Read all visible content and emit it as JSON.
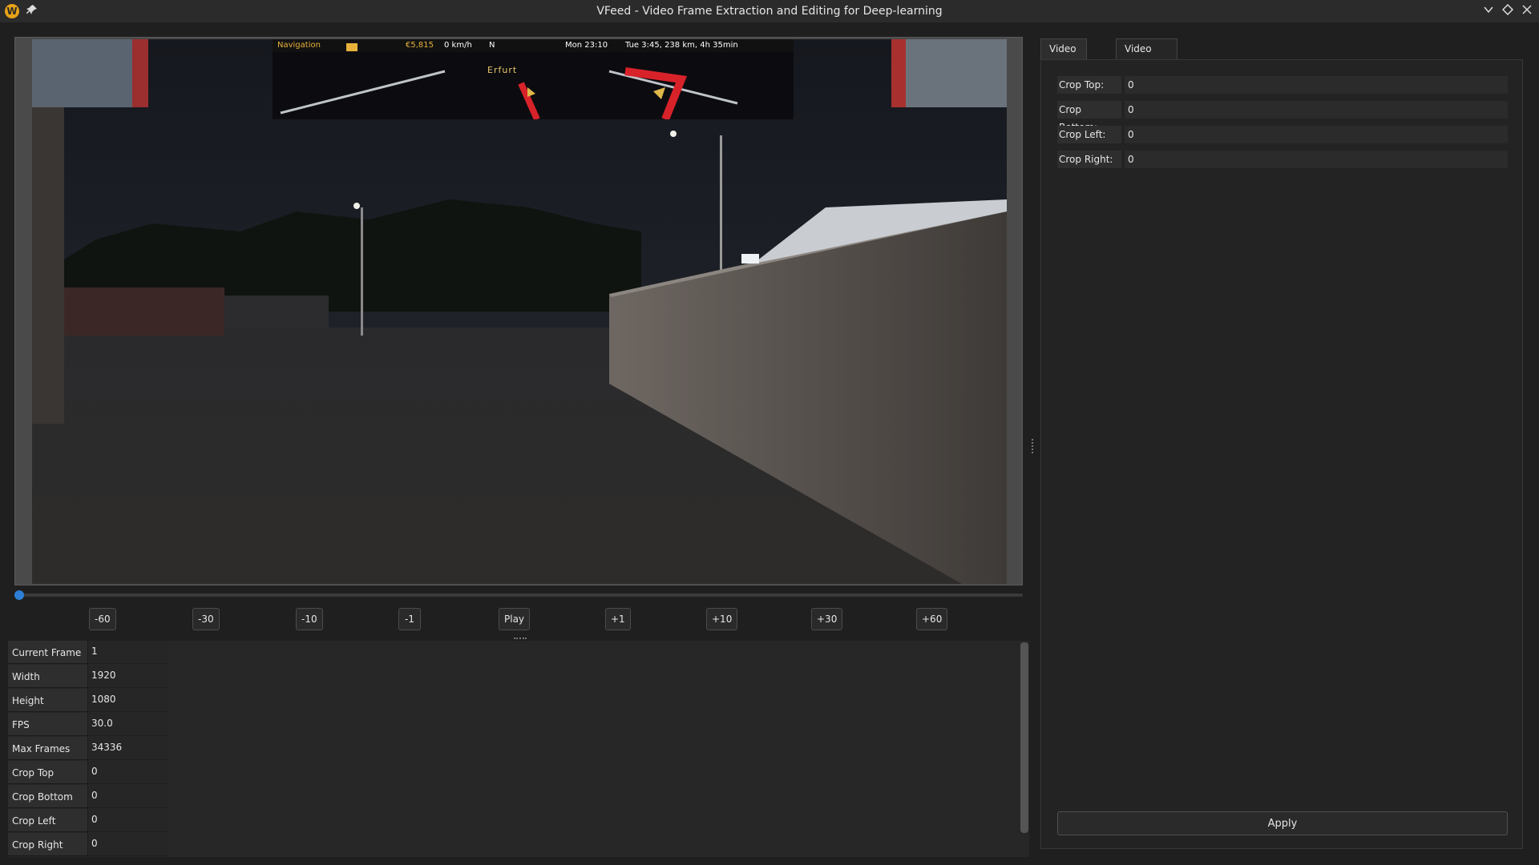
{
  "window": {
    "title": "VFeed - Video Frame Extraction and Editing for Deep-learning",
    "app_icon": "W",
    "icons": [
      "app-icon",
      "pin-icon",
      "chevron-down-icon",
      "diamond-icon",
      "close-icon"
    ]
  },
  "video": {
    "hud": {
      "navigation": "Navigation",
      "money": "€5,815",
      "speed": "0 km/h",
      "direction": "N",
      "time": "Mon 23:10",
      "route": "Tue 3:45, 238 km, 4h 35min",
      "city": "Erfurt"
    },
    "progress_fraction": 0.0
  },
  "controls": {
    "buttons": [
      "-60",
      "-30",
      "-10",
      "-1",
      "Play",
      "+1",
      "+10",
      "+30",
      "+60"
    ]
  },
  "info": {
    "rows": [
      {
        "key": "Current Frame",
        "value": "1"
      },
      {
        "key": "Width",
        "value": "1920"
      },
      {
        "key": "Height",
        "value": "1080"
      },
      {
        "key": "FPS",
        "value": "30.0"
      },
      {
        "key": "Max Frames",
        "value": "34336"
      },
      {
        "key": "Crop Top",
        "value": "0"
      },
      {
        "key": "Crop Bottom",
        "value": "0"
      },
      {
        "key": "Crop Left",
        "value": "0"
      },
      {
        "key": "Crop Right",
        "value": "0"
      }
    ]
  },
  "tabs": {
    "editor": "Video Editor",
    "extractor": "Video Extractor"
  },
  "form": {
    "crop_top_label": "Crop Top:",
    "crop_top_value": "0",
    "crop_bottom_label": "Crop Bottom:",
    "crop_bottom_value": "0",
    "crop_left_label": "Crop Left:",
    "crop_left_value": "0",
    "crop_right_label": "Crop Right:",
    "crop_right_value": "0",
    "apply_label": "Apply"
  },
  "colors": {
    "accent": "#2d7fd6",
    "hud_highlight": "#e8b23a"
  }
}
